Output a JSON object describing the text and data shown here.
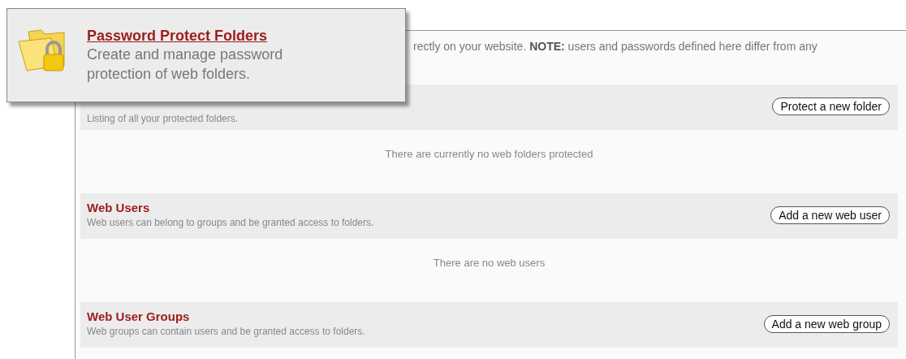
{
  "popup": {
    "title": "Password Protect Folders",
    "description": "Create and manage password protection of web folders."
  },
  "intro": "rectly on your website. **NOTE:** users and passwords defined here differ from any",
  "sections": [
    {
      "description": "Listing of all your protected folders.",
      "button": "Protect a new folder",
      "empty_message": "There are currently no web folders protected"
    },
    {
      "title": "Web Users",
      "description": "Web users can belong to groups and be granted access to folders.",
      "button": "Add a new web user",
      "empty_message": "There are no web users"
    },
    {
      "title": "Web User Groups",
      "description": "Web groups can contain users and be granted access to folders.",
      "button": "Add a new web group"
    }
  ]
}
